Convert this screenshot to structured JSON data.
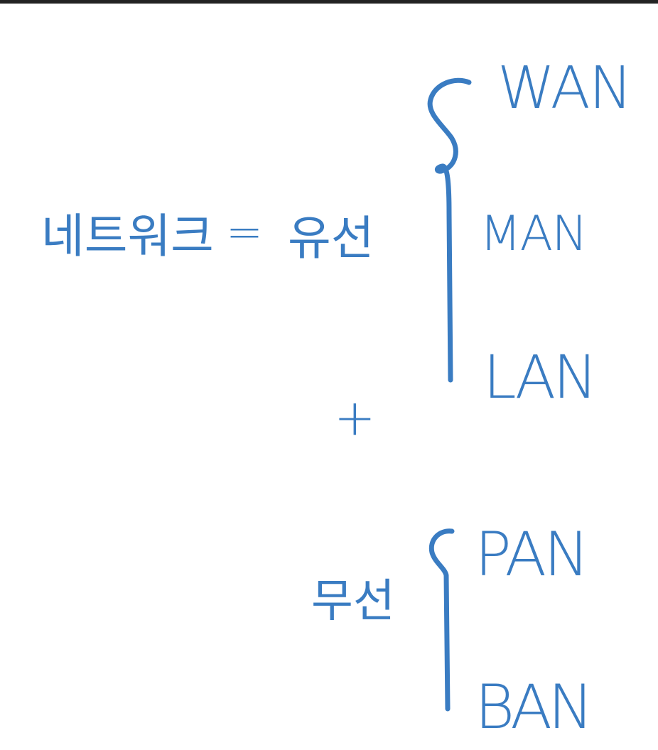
{
  "ink_color": "#3a7cc2",
  "network_term": "네트워크",
  "equals_sign": "=",
  "wired_term": "유선",
  "plus_sign": "+",
  "wireless_term": "무선",
  "wired_types": [
    "WAN",
    "MAN",
    "LAN"
  ],
  "wireless_types": [
    "PAN",
    "BAN"
  ]
}
